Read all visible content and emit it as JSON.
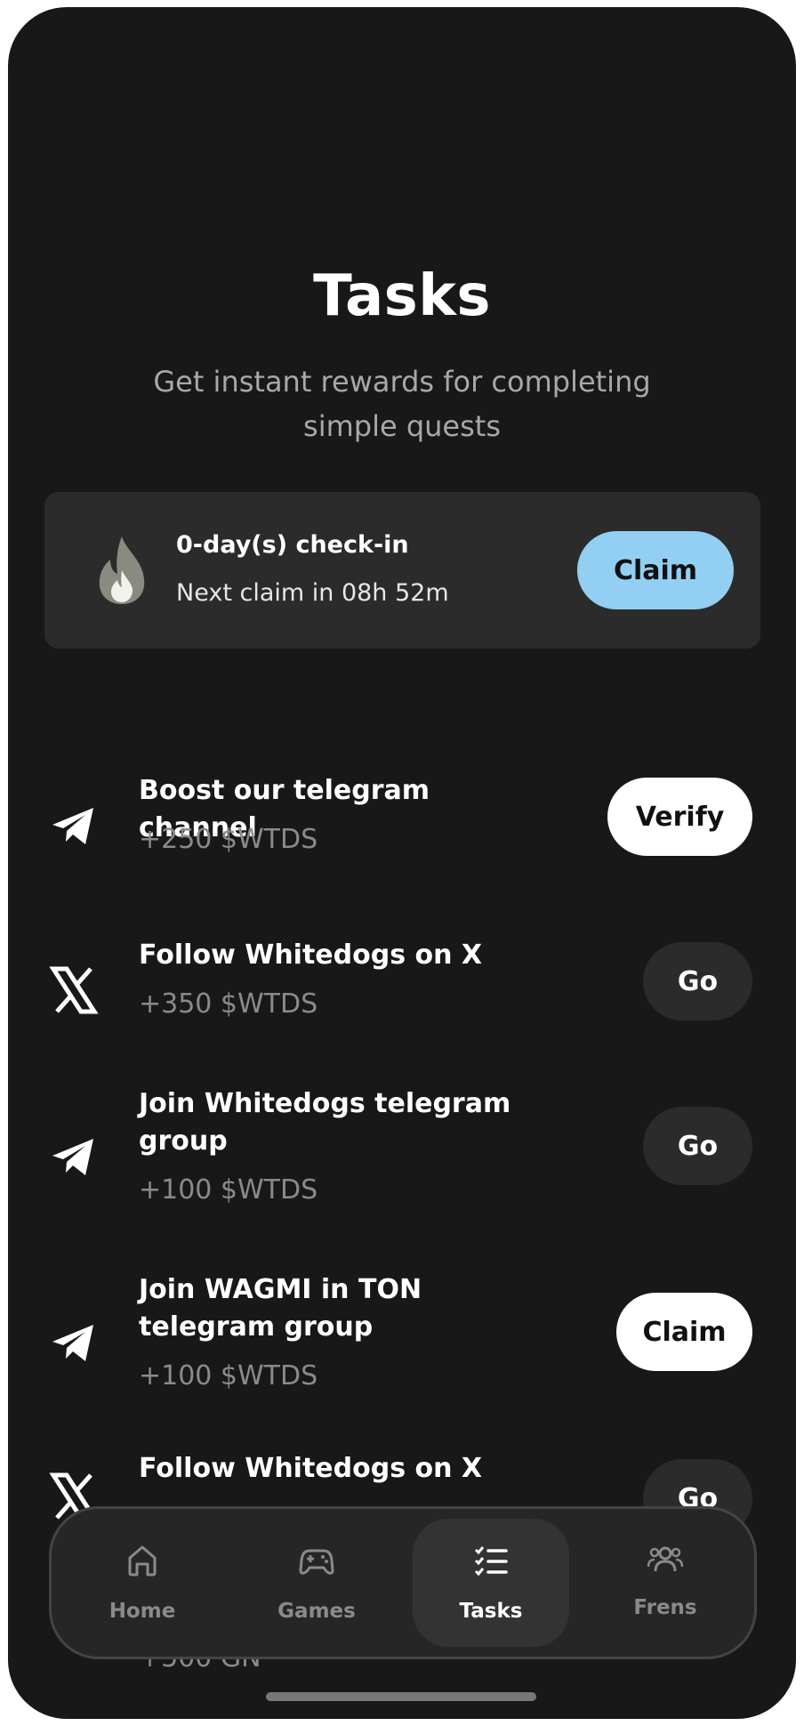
{
  "header": {
    "title": "Tasks",
    "subtitle": "Get instant rewards for completing simple quests"
  },
  "checkin": {
    "title": "0-day(s) check-in",
    "next_claim": "Next claim in 08h 52m",
    "button_label": "Claim",
    "icon": "fire-icon",
    "accent_color": "#92cff2"
  },
  "tasks": [
    {
      "title": "Boost our telegram channel",
      "reward": "+250 $WTDS",
      "button": "Verify",
      "icon": "telegram-icon",
      "style": "white"
    },
    {
      "title": "Follow Whitedogs on X",
      "reward": "+350 $WTDS",
      "button": "Go",
      "icon": "x-logo-icon",
      "style": "dark"
    },
    {
      "title": "Join Whitedogs telegram group",
      "reward": "+100 $WTDS",
      "button": "Go",
      "icon": "telegram-icon",
      "style": "dark"
    },
    {
      "title": "Join WAGMI in TON telegram group",
      "reward": "+100 $WTDS",
      "button": "Claim",
      "icon": "telegram-icon",
      "style": "white"
    },
    {
      "title": "Follow Whitedogs on X",
      "reward": "+500 GN",
      "button": "Go",
      "icon": "x-logo-icon",
      "style": "dark"
    }
  ],
  "nav": {
    "items": [
      {
        "label": "Home",
        "icon": "home-icon",
        "active": false
      },
      {
        "label": "Games",
        "icon": "gamepad-icon",
        "active": false
      },
      {
        "label": "Tasks",
        "icon": "task-list-icon",
        "active": true
      },
      {
        "label": "Frens",
        "icon": "friends-icon",
        "active": false
      }
    ]
  }
}
